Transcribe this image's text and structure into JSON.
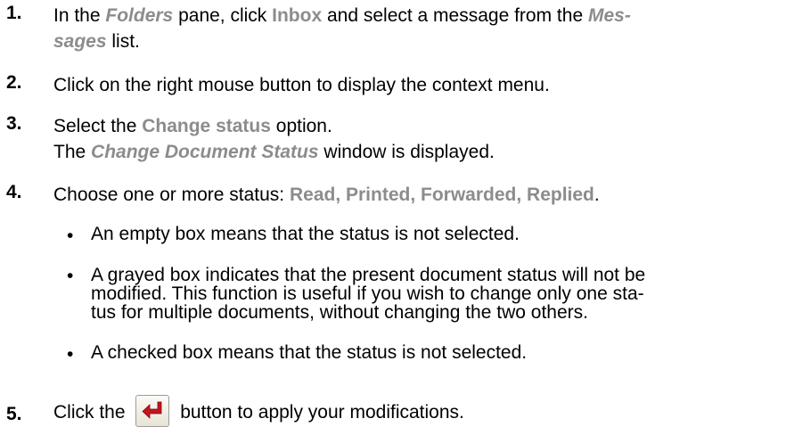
{
  "steps": [
    {
      "number": "1.",
      "parts": [
        "In the ",
        "Folders",
        " pane, click ",
        "Inbox",
        " and select a message from the ",
        "Mes-",
        "sages",
        " list."
      ]
    },
    {
      "number": "2.",
      "text": "Click on the right mouse button to display the context menu."
    },
    {
      "number": "3.",
      "parts": [
        "Select the ",
        "Change status",
        " option."
      ],
      "line2": [
        "The ",
        "Change Document Status",
        " window is displayed."
      ]
    },
    {
      "number": "4.",
      "parts": [
        "Choose one or more status: ",
        "Read, Printed, Forwarded, Replied",
        "."
      ]
    },
    {
      "number": "5.",
      "parts": [
        "Click the ",
        " button to apply your modifications."
      ]
    }
  ],
  "bullets": [
    {
      "symbol": "•",
      "text": "An empty box means that the status is not selected."
    },
    {
      "symbol": "•",
      "lines": [
        "A grayed box indicates that the present document status will not be",
        "modified. This function is useful if you wish to change only one sta-",
        "tus for multiple documents, without changing the two others."
      ]
    },
    {
      "symbol": "•",
      "text": "A checked box means that the status is not selected."
    }
  ],
  "icons": {
    "apply_button": "enter-return-icon"
  },
  "colors": {
    "highlight": "#8c8c8c",
    "arrow": "#c4141c"
  }
}
